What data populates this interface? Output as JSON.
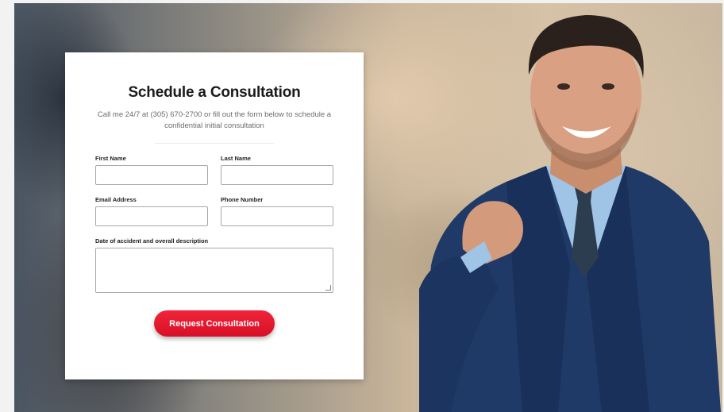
{
  "form": {
    "title": "Schedule a Consultation",
    "subtitle": "Call me 24/7 at (305) 670-2700 or fill out the form below to schedule a confidential initial consultation",
    "fields": {
      "first_name": {
        "label": "First Name",
        "value": ""
      },
      "last_name": {
        "label": "Last Name",
        "value": ""
      },
      "email": {
        "label": "Email Address",
        "value": ""
      },
      "phone": {
        "label": "Phone Number",
        "value": ""
      },
      "description": {
        "label": "Date of accident and overall description",
        "value": ""
      }
    },
    "submit_label": "Request Consultation"
  },
  "colors": {
    "accent": "#e41b30",
    "card_background": "#ffffff",
    "suit": "#1f3a66"
  }
}
